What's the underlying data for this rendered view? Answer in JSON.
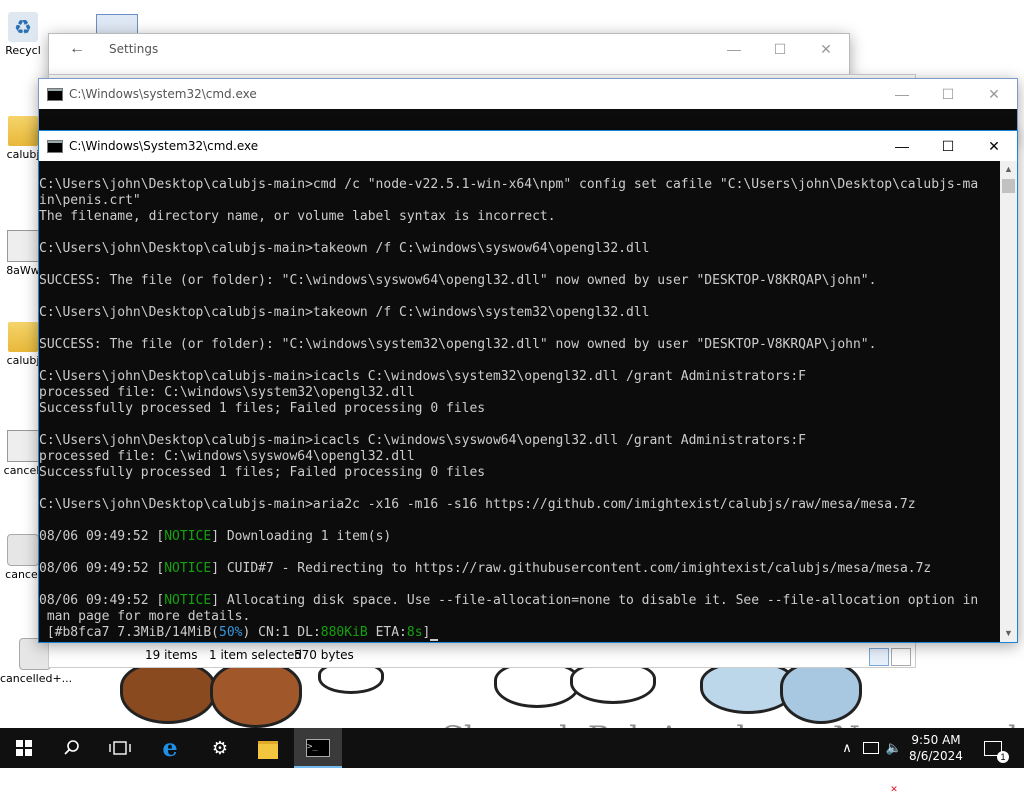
{
  "desktop": {
    "icons": [
      {
        "label": "Recycl",
        "kind": "recycle"
      },
      {
        "label": "calubj",
        "kind": "folder"
      },
      {
        "label": "8aWw",
        "kind": "doc"
      },
      {
        "label": "calubj",
        "kind": "folder"
      },
      {
        "label": "cancell",
        "kind": "doc"
      },
      {
        "label": "cancel",
        "kind": "gear"
      },
      {
        "label": "cancelled+...",
        "kind": "gear"
      }
    ],
    "watermark": "CherrydoBoloAconha on Newgrounds"
  },
  "settings_window": {
    "title": "Settings"
  },
  "explorer_window": {
    "status_items": "19 items",
    "status_selected": "1 item selected",
    "status_size": "570 bytes"
  },
  "cmd_back": {
    "title": "C:\\Windows\\system32\\cmd.exe"
  },
  "cmd_front": {
    "title": "C:\\Windows\\System32\\cmd.exe",
    "lines": [
      {
        "parts": [
          {
            "t": "C:\\Users\\john\\Desktop\\calubjs-main>cmd /c \"node-v22.5.1-win-x64\\npm\" config set cafile \"C:\\Users\\john\\Desktop\\calubjs-ma"
          }
        ]
      },
      {
        "parts": [
          {
            "t": "in\\penis.crt\""
          }
        ]
      },
      {
        "parts": [
          {
            "t": "The filename, directory name, or volume label syntax is incorrect."
          }
        ]
      },
      {
        "parts": [
          {
            "t": ""
          }
        ]
      },
      {
        "parts": [
          {
            "t": "C:\\Users\\john\\Desktop\\calubjs-main>takeown /f C:\\windows\\syswow64\\opengl32.dll"
          }
        ]
      },
      {
        "parts": [
          {
            "t": ""
          }
        ]
      },
      {
        "parts": [
          {
            "t": "SUCCESS: The file (or folder): \"C:\\windows\\syswow64\\opengl32.dll\" now owned by user \"DESKTOP-V8KRQAP\\john\"."
          }
        ]
      },
      {
        "parts": [
          {
            "t": ""
          }
        ]
      },
      {
        "parts": [
          {
            "t": "C:\\Users\\john\\Desktop\\calubjs-main>takeown /f C:\\windows\\system32\\opengl32.dll"
          }
        ]
      },
      {
        "parts": [
          {
            "t": ""
          }
        ]
      },
      {
        "parts": [
          {
            "t": "SUCCESS: The file (or folder): \"C:\\windows\\system32\\opengl32.dll\" now owned by user \"DESKTOP-V8KRQAP\\john\"."
          }
        ]
      },
      {
        "parts": [
          {
            "t": ""
          }
        ]
      },
      {
        "parts": [
          {
            "t": "C:\\Users\\john\\Desktop\\calubjs-main>icacls C:\\windows\\system32\\opengl32.dll /grant Administrators:F"
          }
        ]
      },
      {
        "parts": [
          {
            "t": "processed file: C:\\windows\\system32\\opengl32.dll"
          }
        ]
      },
      {
        "parts": [
          {
            "t": "Successfully processed 1 files; Failed processing 0 files"
          }
        ]
      },
      {
        "parts": [
          {
            "t": ""
          }
        ]
      },
      {
        "parts": [
          {
            "t": "C:\\Users\\john\\Desktop\\calubjs-main>icacls C:\\windows\\syswow64\\opengl32.dll /grant Administrators:F"
          }
        ]
      },
      {
        "parts": [
          {
            "t": "processed file: C:\\windows\\syswow64\\opengl32.dll"
          }
        ]
      },
      {
        "parts": [
          {
            "t": "Successfully processed 1 files; Failed processing 0 files"
          }
        ]
      },
      {
        "parts": [
          {
            "t": ""
          }
        ]
      },
      {
        "parts": [
          {
            "t": "C:\\Users\\john\\Desktop\\calubjs-main>aria2c -x16 -m16 -s16 https://github.com/imightexist/calubjs/raw/mesa/mesa.7z"
          }
        ]
      },
      {
        "parts": [
          {
            "t": ""
          }
        ]
      },
      {
        "parts": [
          {
            "t": "08/06 09:49:52 ["
          },
          {
            "t": "NOTICE",
            "c": "green"
          },
          {
            "t": "] Downloading 1 item(s)"
          }
        ]
      },
      {
        "parts": [
          {
            "t": ""
          }
        ]
      },
      {
        "parts": [
          {
            "t": "08/06 09:49:52 ["
          },
          {
            "t": "NOTICE",
            "c": "green"
          },
          {
            "t": "] CUID#7 - Redirecting to https://raw.githubusercontent.com/imightexist/calubjs/mesa/mesa.7z"
          }
        ]
      },
      {
        "parts": [
          {
            "t": ""
          }
        ]
      },
      {
        "parts": [
          {
            "t": "08/06 09:49:52 ["
          },
          {
            "t": "NOTICE",
            "c": "green"
          },
          {
            "t": "] Allocating disk space. Use --file-allocation=none to disable it. See --file-allocation option in"
          }
        ]
      },
      {
        "parts": [
          {
            "t": " man page for more details."
          }
        ]
      },
      {
        "parts": [
          {
            "t": " [#b8fca7 7.3MiB/14MiB("
          },
          {
            "t": "50%",
            "c": "cyan"
          },
          {
            "t": ") CN:1 DL:"
          },
          {
            "t": "880KiB",
            "c": "green"
          },
          {
            "t": " ETA:"
          },
          {
            "t": "8s",
            "c": "green"
          },
          {
            "t": "]"
          }
        ],
        "cursor": true
      }
    ]
  },
  "taskbar": {
    "start_icon": "windows-start-icon",
    "search_icon": "search-icon",
    "taskview_icon": "task-view-icon",
    "apps": [
      "internet-explorer-icon",
      "settings-gear-icon",
      "file-explorer-icon",
      "cmd-icon"
    ],
    "time": "9:50 AM",
    "date": "8/6/2024",
    "notification_count": "1"
  }
}
